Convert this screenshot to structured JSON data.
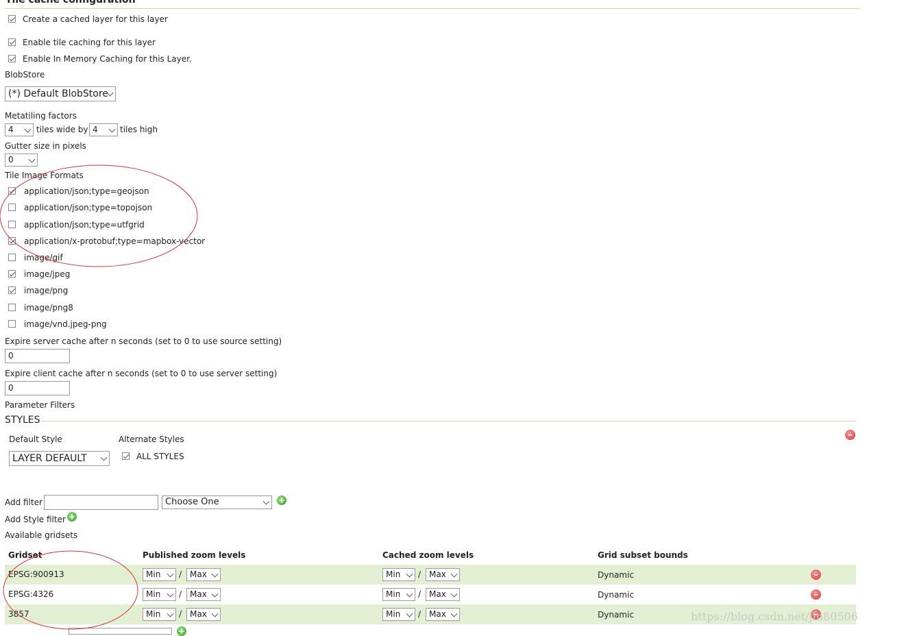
{
  "section_title": "Tile cache configuration",
  "checks": {
    "create_cached_layer": "Create a cached layer for this layer",
    "enable_tile_caching": "Enable tile caching for this layer",
    "enable_memory_caching": "Enable In Memory Caching for this Layer."
  },
  "blobstore": {
    "label": "BlobStore",
    "value": "(*) Default BlobStore"
  },
  "metatiling": {
    "label": "Metatiling factors",
    "wide": "4",
    "wide_label": "tiles wide by",
    "high": "4",
    "high_label": "tiles high"
  },
  "gutter": {
    "label": "Gutter size in pixels",
    "value": "0"
  },
  "formats": {
    "label": "Tile Image Formats",
    "items": [
      {
        "label": "application/json;type=geojson",
        "checked": true
      },
      {
        "label": "application/json;type=topojson",
        "checked": false
      },
      {
        "label": "application/json;type=utfgrid",
        "checked": false
      },
      {
        "label": "application/x-protobuf;type=mapbox-vector",
        "checked": true
      },
      {
        "label": "image/gif",
        "checked": false
      },
      {
        "label": "image/jpeg",
        "checked": true
      },
      {
        "label": "image/png",
        "checked": true
      },
      {
        "label": "image/png8",
        "checked": false
      },
      {
        "label": "image/vnd.jpeg-png",
        "checked": false
      }
    ]
  },
  "expire_server": {
    "label": "Expire server cache after n seconds (set to 0 to use source setting)",
    "value": "0"
  },
  "expire_client": {
    "label": "Expire client cache after n seconds (set to 0 to use server setting)",
    "value": "0"
  },
  "parameter_filters": {
    "label": "Parameter Filters"
  },
  "styles": {
    "title": "STYLES",
    "default_label": "Default Style",
    "default_value": "LAYER DEFAULT",
    "alternate_label": "Alternate Styles",
    "all_styles": "ALL STYLES"
  },
  "add_filter": {
    "label": "Add filter",
    "input_value": "",
    "choose": "Choose One"
  },
  "add_style_filter": {
    "label": "Add Style filter"
  },
  "gridsets": {
    "label": "Available gridsets",
    "headers": {
      "gridset": "Gridset",
      "published": "Published zoom levels",
      "cached": "Cached zoom levels",
      "bounds": "Grid subset bounds"
    },
    "rows": [
      {
        "name": "EPSG:900913",
        "pub_min": "Min",
        "pub_max": "Max",
        "cache_min": "Min",
        "cache_max": "Max",
        "bounds": "Dynamic"
      },
      {
        "name": "EPSG:4326",
        "pub_min": "Min",
        "pub_max": "Max",
        "cache_min": "Min",
        "cache_max": "Max",
        "bounds": "Dynamic"
      },
      {
        "name": "3857",
        "pub_min": "Min",
        "pub_max": "Max",
        "cache_min": "Min",
        "cache_max": "Max",
        "bounds": "Dynamic"
      }
    ],
    "slash": "/"
  },
  "watermark": "https://blog.csdn.net/jin80506"
}
